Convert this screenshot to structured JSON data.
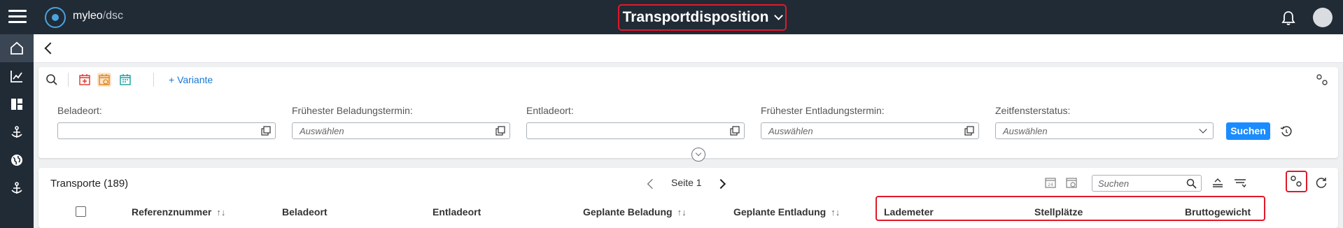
{
  "app": {
    "brand_name": "myleo",
    "brand_separator": "/",
    "brand_product": "dsc",
    "page_title": "Transportdisposition"
  },
  "sidebar": {
    "items": [
      {
        "icon": "home-icon",
        "active": true
      },
      {
        "icon": "chart-icon",
        "active": false
      },
      {
        "icon": "dashboard-icon",
        "active": false
      },
      {
        "icon": "anchor-icon",
        "active": false
      },
      {
        "icon": "globe-icon",
        "active": false
      },
      {
        "icon": "anchor-icon",
        "active": false
      }
    ]
  },
  "filter": {
    "variant_label": "+ Variante",
    "fields": [
      {
        "label": "Beladeort:",
        "placeholder": ""
      },
      {
        "label": "Frühester Beladungstermin:",
        "placeholder": "Auswählen"
      },
      {
        "label": "Entladeort:",
        "placeholder": ""
      },
      {
        "label": "Frühester Entladungstermin:",
        "placeholder": "Auswählen"
      },
      {
        "label": "Zeitfensterstatus:",
        "placeholder": "Auswählen"
      }
    ],
    "search_button": "Suchen"
  },
  "table": {
    "title": "Transporte (189)",
    "pager_label": "Seite 1",
    "search_placeholder": "Suchen",
    "columns": [
      {
        "label": "Referenznummer",
        "sort": "↑↓"
      },
      {
        "label": "Beladeort",
        "sort": ""
      },
      {
        "label": "Entladeort",
        "sort": ""
      },
      {
        "label": "Geplante Beladung",
        "sort": "↑↓"
      },
      {
        "label": "Geplante Entladung",
        "sort": "↑↓"
      },
      {
        "label": "Lademeter",
        "sort": ""
      },
      {
        "label": "Stellplätze",
        "sort": ""
      },
      {
        "label": "Bruttogewicht",
        "sort": ""
      }
    ]
  },
  "colors": {
    "topbar": "#212b36",
    "accent": "#1a8cff",
    "highlight": "#e0192a"
  }
}
